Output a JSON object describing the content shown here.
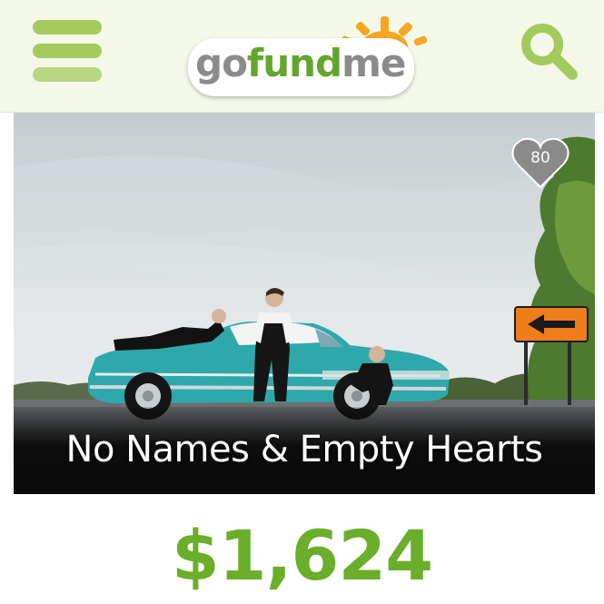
{
  "header": {
    "logo": {
      "part1": "go",
      "part2": "fund",
      "part3": "me"
    }
  },
  "icons": {
    "menu": "hamburger-menu-icon",
    "search": "search-icon",
    "like": "heart-icon"
  },
  "campaign": {
    "title": "No Names & Empty Hearts",
    "likes": "80",
    "amount_raised": "$1,624"
  },
  "colors": {
    "brand_green": "#6aae2a",
    "menu_green": "#a3ca5c",
    "header_bg": "#f4f8e8",
    "logo_sun": "#f5a623",
    "heart_gray": "#8a8a8a"
  }
}
